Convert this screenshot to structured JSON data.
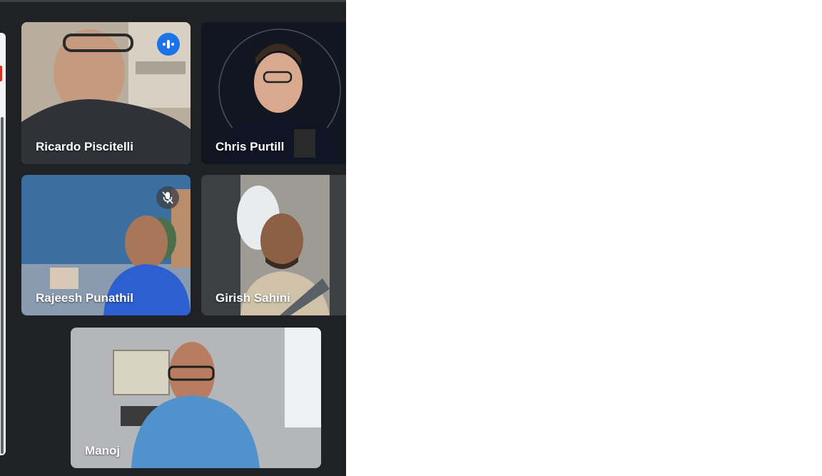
{
  "participants": [
    {
      "name": "Ricardo Piscitelli",
      "status": "speaking"
    },
    {
      "name": "Chris Purtill",
      "status": "none"
    },
    {
      "name": "Rajeesh Punathil",
      "status": "muted"
    },
    {
      "name": "Girish Sahini",
      "status": "none"
    },
    {
      "name": "Manoj",
      "status": "none"
    }
  ],
  "icons": {
    "speaking": "audio-levels-icon",
    "muted": "mic-off-icon"
  },
  "colors": {
    "background": "#202124",
    "tile": "#3c4043",
    "active_border": "#8ab4f8",
    "speaking_badge": "#1a73e8",
    "name_text": "#ffffff"
  }
}
